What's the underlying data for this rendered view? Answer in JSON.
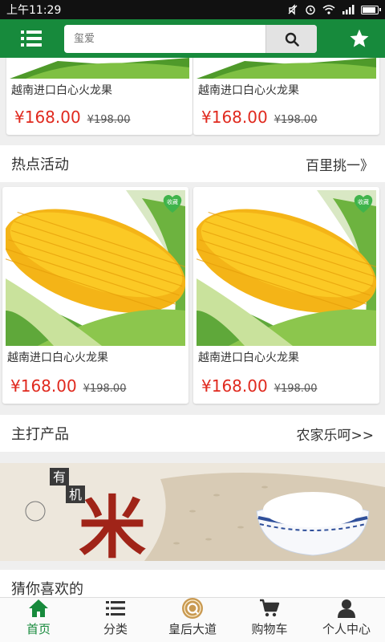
{
  "status_bar": {
    "time": "上午11:29"
  },
  "header": {
    "search_placeholder": "玺爱",
    "menu_icon": "menu-icon",
    "search_icon": "search-icon",
    "favorite_icon": "star-icon"
  },
  "top_products": [
    {
      "title": "越南进口白心火龙果",
      "price": "¥168.00",
      "old_price": "¥198.00"
    },
    {
      "title": "越南进口白心火龙果",
      "price": "¥168.00",
      "old_price": "¥198.00"
    }
  ],
  "hot_section": {
    "title": "热点活动",
    "more": "百里挑一》"
  },
  "hot_products": [
    {
      "title": "越南进口白心火龙果",
      "price": "¥168.00",
      "old_price": "¥198.00",
      "badge": "收藏"
    },
    {
      "title": "越南进口白心火龙果",
      "price": "¥168.00",
      "old_price": "¥198.00",
      "badge": "收藏"
    }
  ],
  "main_section": {
    "title": "主打产品",
    "more": "农家乐呵>>"
  },
  "banner": {
    "tag1": "有",
    "tag2": "机",
    "big_char": "米"
  },
  "guess_section": {
    "title": "猜你喜欢的"
  },
  "bottom_nav": [
    {
      "label": "首页",
      "icon": "home-icon",
      "active": true
    },
    {
      "label": "分类",
      "icon": "list-icon",
      "active": false
    },
    {
      "label": "皇后大道",
      "icon": "q-badge-icon",
      "active": false
    },
    {
      "label": "购物车",
      "icon": "cart-icon",
      "active": false
    },
    {
      "label": "个人中心",
      "icon": "user-icon",
      "active": false
    }
  ],
  "colors": {
    "brand_green": "#178a3c",
    "price_red": "#e0291e"
  }
}
